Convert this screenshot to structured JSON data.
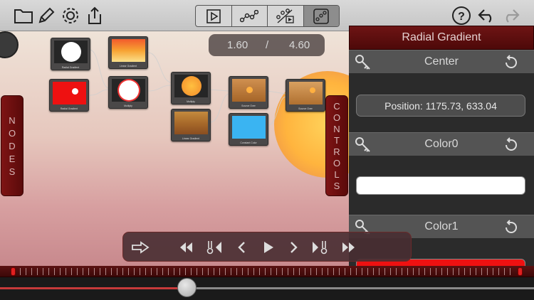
{
  "toolbar": {
    "left_icons": [
      "folder-icon",
      "pencil-icon",
      "gear-icon",
      "share-icon"
    ],
    "modes": [
      "play-mode-icon",
      "node-graph-icon",
      "node-preview-icon",
      "node-edit-icon"
    ],
    "active_mode": 3,
    "right_icons": [
      "help-icon",
      "undo-icon",
      "redo-icon"
    ]
  },
  "canvas": {
    "time_current": "1.60",
    "time_separator": "/",
    "time_total": "4.60",
    "nodes_tab_letters": [
      "N",
      "O",
      "D",
      "E",
      "S"
    ],
    "controls_tab_letters": [
      "C",
      "O",
      "N",
      "T",
      "R",
      "O",
      "L",
      "S"
    ],
    "nodes": [
      {
        "label": "Radial Gradient"
      },
      {
        "label": "Linear Gradient"
      },
      {
        "label": "Radial Gradient"
      },
      {
        "label": "Multiply"
      },
      {
        "label": "Multiply"
      },
      {
        "label": "Linear Gradient"
      },
      {
        "label": "Source Over"
      },
      {
        "label": "Constant Color"
      },
      {
        "label": "Source Over"
      }
    ]
  },
  "panel": {
    "title": "Radial Gradient",
    "properties": [
      {
        "name": "Center",
        "value": "Position: 1175.73, 633.04"
      },
      {
        "name": "Color0",
        "color": "#ffffff"
      },
      {
        "name": "Color1",
        "color": "#ee1111"
      }
    ]
  },
  "transport": {
    "buttons": [
      "arrow-right-icon",
      "rewind-icon",
      "prev-keyframe-icon",
      "step-back-icon",
      "play-icon",
      "step-forward-icon",
      "next-keyframe-icon",
      "fast-forward-icon"
    ]
  },
  "timeline": {
    "playhead_fraction": 0.35
  },
  "colors": {
    "accent": "#6e1414",
    "toolbar": "#d0d0d0",
    "panel": "#3e3e3e"
  }
}
